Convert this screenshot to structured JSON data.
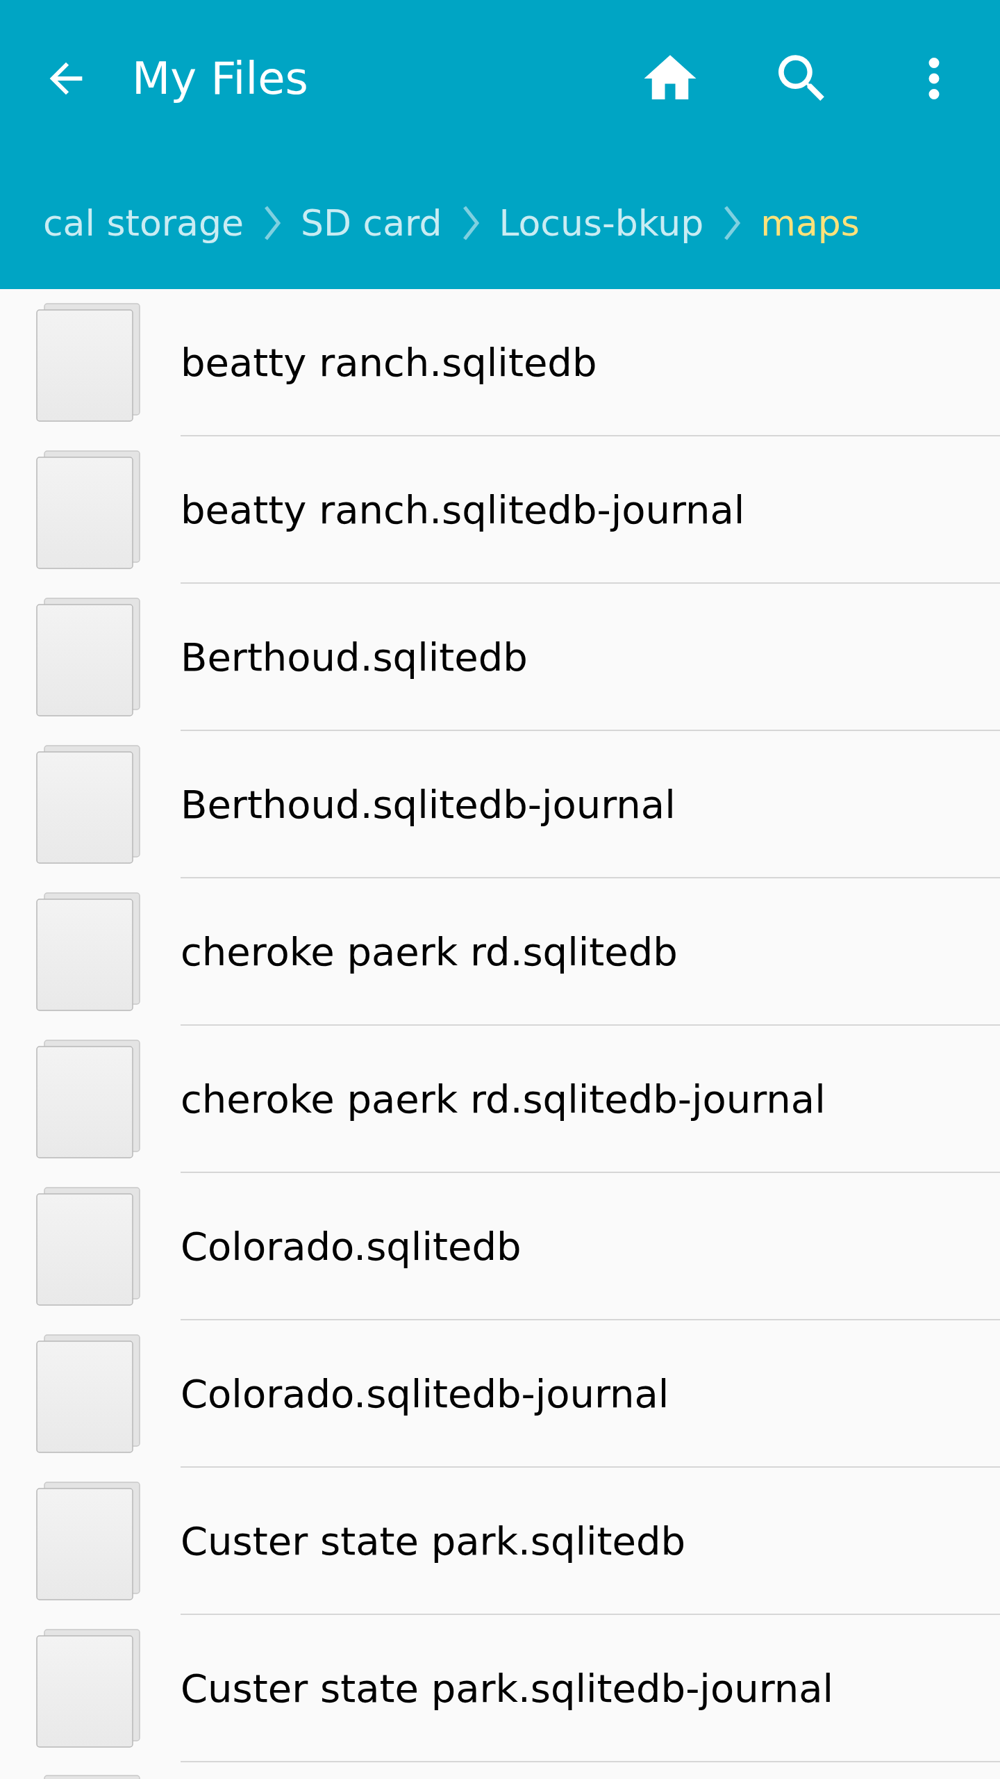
{
  "app_bar": {
    "title": "My Files"
  },
  "breadcrumbs": [
    {
      "label": "cal storage",
      "selected": false
    },
    {
      "label": "SD card",
      "selected": false
    },
    {
      "label": "Locus-bkup",
      "selected": false
    },
    {
      "label": "maps",
      "selected": true
    }
  ],
  "files": [
    {
      "name": "beatty ranch.sqlitedb"
    },
    {
      "name": "beatty ranch.sqlitedb-journal"
    },
    {
      "name": "Berthoud.sqlitedb"
    },
    {
      "name": "Berthoud.sqlitedb-journal"
    },
    {
      "name": "cheroke paerk rd.sqlitedb"
    },
    {
      "name": "cheroke paerk rd.sqlitedb-journal"
    },
    {
      "name": "Colorado.sqlitedb"
    },
    {
      "name": "Colorado.sqlitedb-journal"
    },
    {
      "name": "Custer state park.sqlitedb"
    },
    {
      "name": "Custer state park.sqlitedb-journal"
    }
  ]
}
